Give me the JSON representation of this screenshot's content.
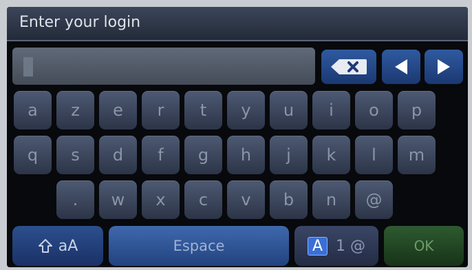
{
  "title": "Enter your login",
  "input": {
    "value": ""
  },
  "controls": {
    "backspace_icon": "backspace-icon",
    "left_icon": "left-arrow-icon",
    "right_icon": "right-arrow-icon"
  },
  "keys": {
    "row1": [
      "a",
      "z",
      "e",
      "r",
      "t",
      "y",
      "u",
      "i",
      "o",
      "p"
    ],
    "row2": [
      "q",
      "s",
      "d",
      "f",
      "g",
      "h",
      "j",
      "k",
      "l",
      "m"
    ],
    "row3": [
      ".",
      "w",
      "x",
      "c",
      "v",
      "b",
      "n",
      "@"
    ]
  },
  "bottom": {
    "shift_icon": "shift-icon",
    "shift_label": "aA",
    "space_label": "Espace",
    "mode_active": "A",
    "mode_rest": "1 @",
    "ok_label": "OK"
  },
  "colors": {
    "key_text": "#8b95a7",
    "accent_blue": "#2f5aa0",
    "ok_green": "#2d5a30",
    "screen_bg": "#08090c"
  }
}
